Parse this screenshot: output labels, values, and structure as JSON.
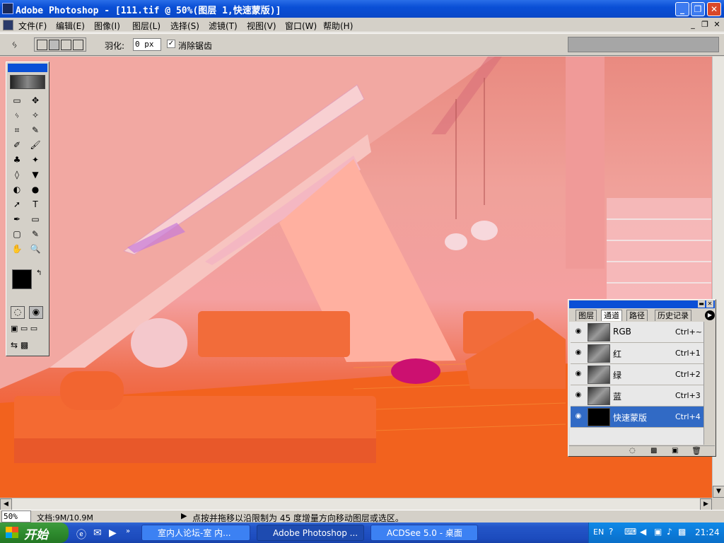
{
  "window": {
    "title": "Adobe Photoshop - [111.tif @ 50%(图层 1,快速蒙版)]",
    "min": "_",
    "restore": "❐",
    "close": "✕"
  },
  "menu": [
    "文件(F)",
    "编辑(E)",
    "图像(I)",
    "图层(L)",
    "选择(S)",
    "滤镜(T)",
    "视图(V)",
    "窗口(W)",
    "帮助(H)"
  ],
  "options": {
    "feather_label": "羽化:",
    "feather_value": "0 px",
    "antialias_label": "消除锯齿",
    "antialias_checked": true
  },
  "toolbox": {
    "tools": [
      [
        "▭",
        "✥"
      ],
      [
        "ᛃ",
        "✧"
      ],
      [
        "⌗",
        "✎"
      ],
      [
        "✐",
        "🖌"
      ],
      [
        "♣",
        "✦"
      ],
      [
        "◊",
        "▼"
      ],
      [
        "◐",
        "●"
      ],
      [
        "➚",
        "T"
      ],
      [
        "✒",
        "▭"
      ],
      [
        "▢",
        "✎"
      ],
      [
        "✋",
        "🔍"
      ]
    ]
  },
  "panel": {
    "tabs": [
      "图层",
      "通道",
      "路径",
      "历史记录"
    ],
    "channels": [
      {
        "name": "RGB",
        "key": "Ctrl+~"
      },
      {
        "name": "红",
        "key": "Ctrl+1"
      },
      {
        "name": "绿",
        "key": "Ctrl+2"
      },
      {
        "name": "蓝",
        "key": "Ctrl+3"
      },
      {
        "name": "快速蒙版",
        "key": "Ctrl+4"
      }
    ]
  },
  "status": {
    "zoom": "50%",
    "doc": "文档:9M/10.9M",
    "hint": "点按并拖移以沿限制为 45 度增量方向移动图层或选区。"
  },
  "taskbar": {
    "start": "开始",
    "tasks": [
      "室内人论坛-室 内...",
      "Adobe Photoshop ...",
      "ACDSee 5.0 - 桌面"
    ],
    "lang": "EN",
    "time": "21:24"
  },
  "colors": {
    "accent": "#0a4fd6",
    "selected": "#316ac5"
  }
}
